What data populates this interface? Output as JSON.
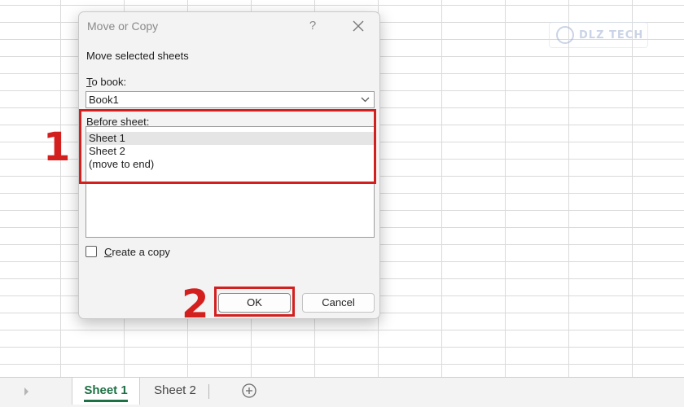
{
  "dialog": {
    "title": "Move or Copy",
    "help_label": "?",
    "subtitle": "Move selected sheets",
    "to_book_label_u": "T",
    "to_book_label_rest": "o book:",
    "to_book_value": "Book1",
    "before_sheet_label_u": "B",
    "before_sheet_label_rest": "efore sheet:",
    "sheets": [
      "Sheet 1",
      "Sheet 2",
      "(move to end)"
    ],
    "create_copy_u": "C",
    "create_copy_rest": "reate a copy",
    "create_copy_checked": false,
    "ok_label": "OK",
    "cancel_label": "Cancel"
  },
  "annotations": {
    "step1": "1",
    "step2": "2",
    "color": "#d41f1f"
  },
  "watermark": {
    "text": "DLZ TECH"
  },
  "sheet_tabs": {
    "active": "Sheet 1",
    "inactive": "Sheet 2"
  }
}
